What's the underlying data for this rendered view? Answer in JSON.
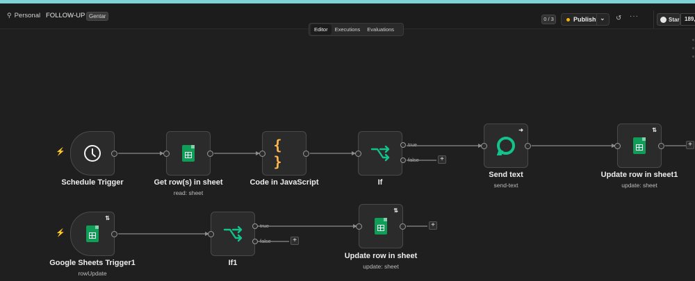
{
  "header": {
    "project": "Personal",
    "workflow_name": "FOLLOW-UP",
    "tag": "Gentar",
    "counter": "0 / 3",
    "publish_label": "Publish",
    "star_label": "Star",
    "star_count": "189,4"
  },
  "tabs": [
    {
      "label": "Editor",
      "active": true
    },
    {
      "label": "Executions",
      "active": false
    },
    {
      "label": "Evaluations",
      "active": false
    }
  ],
  "nodes": {
    "schedule": {
      "title": "Schedule Trigger",
      "subtitle": ""
    },
    "get_rows": {
      "title": "Get row(s) in sheet",
      "subtitle": "read: sheet"
    },
    "code": {
      "title": "Code in JavaScript",
      "subtitle": ""
    },
    "if": {
      "title": "If",
      "subtitle": ""
    },
    "send_text": {
      "title": "Send text",
      "subtitle": "send-text"
    },
    "update1": {
      "title": "Update row in sheet1",
      "subtitle": "update: sheet"
    },
    "gs_trigger": {
      "title": "Google Sheets Trigger1",
      "subtitle": "rowUpdate"
    },
    "if1": {
      "title": "If1",
      "subtitle": ""
    },
    "update": {
      "title": "Update row in sheet",
      "subtitle": "update: sheet"
    }
  },
  "branches": {
    "true_label": "true",
    "false_label": "false"
  },
  "colors": {
    "accent_teal": "#7ed3d6",
    "sheets_green": "#0f9d58",
    "if_green": "#13c38b",
    "code_orange": "#ffb84d",
    "trigger_bolt": "#ff6b35"
  },
  "icons": [
    "clock-icon",
    "google-sheets-icon",
    "code-braces-icon",
    "if-branch-icon",
    "chat-icon",
    "sync-icon",
    "lightning-icon",
    "history-icon",
    "more-icon",
    "github-icon",
    "person-icon",
    "chevron-down-icon",
    "plus-icon",
    "arrow-right-icon"
  ]
}
